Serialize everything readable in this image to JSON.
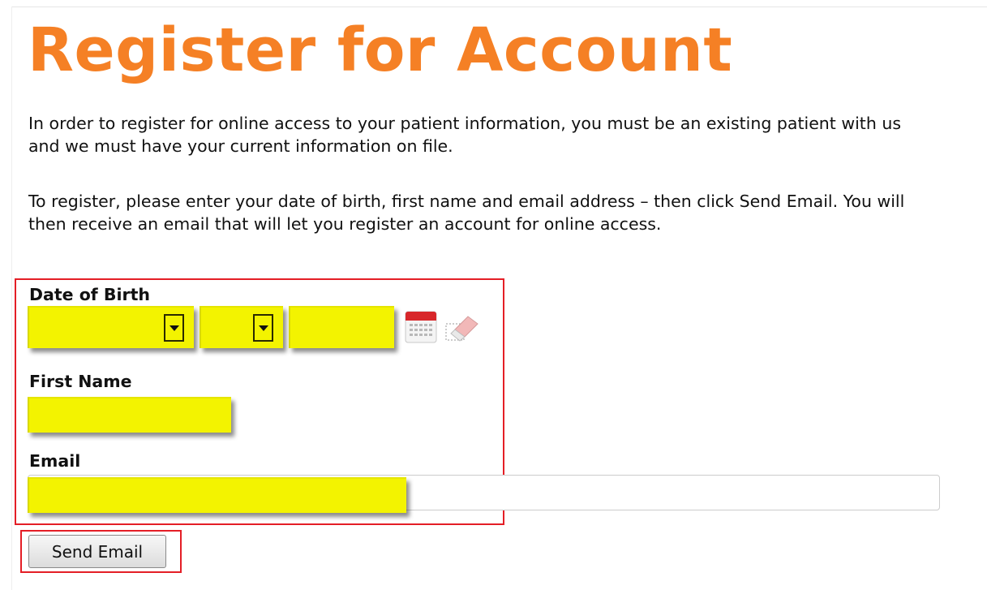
{
  "page": {
    "title": "Register for Account",
    "intro": "In order to register for online access to your patient information, you must be an existing patient with us and we must have your current information on file.",
    "instructions": "To register, please enter your date of birth, first name and email address – then click Send Email. You will then receive an email that will let you register an account for online access."
  },
  "form": {
    "dob_label": "Date of Birth",
    "first_name_label": "First Name",
    "email_label": "Email",
    "month_value": "",
    "day_value": "",
    "year_value": "",
    "first_name_value": "",
    "email_value": "",
    "submit_label": "Send Email"
  },
  "icons": {
    "calendar": "calendar-icon",
    "clear": "eraser-icon",
    "dropdown": "chevron-down-icon"
  },
  "colors": {
    "title": "#f58025",
    "field_highlight": "#f3f300",
    "annotation_box": "#e41e26"
  }
}
